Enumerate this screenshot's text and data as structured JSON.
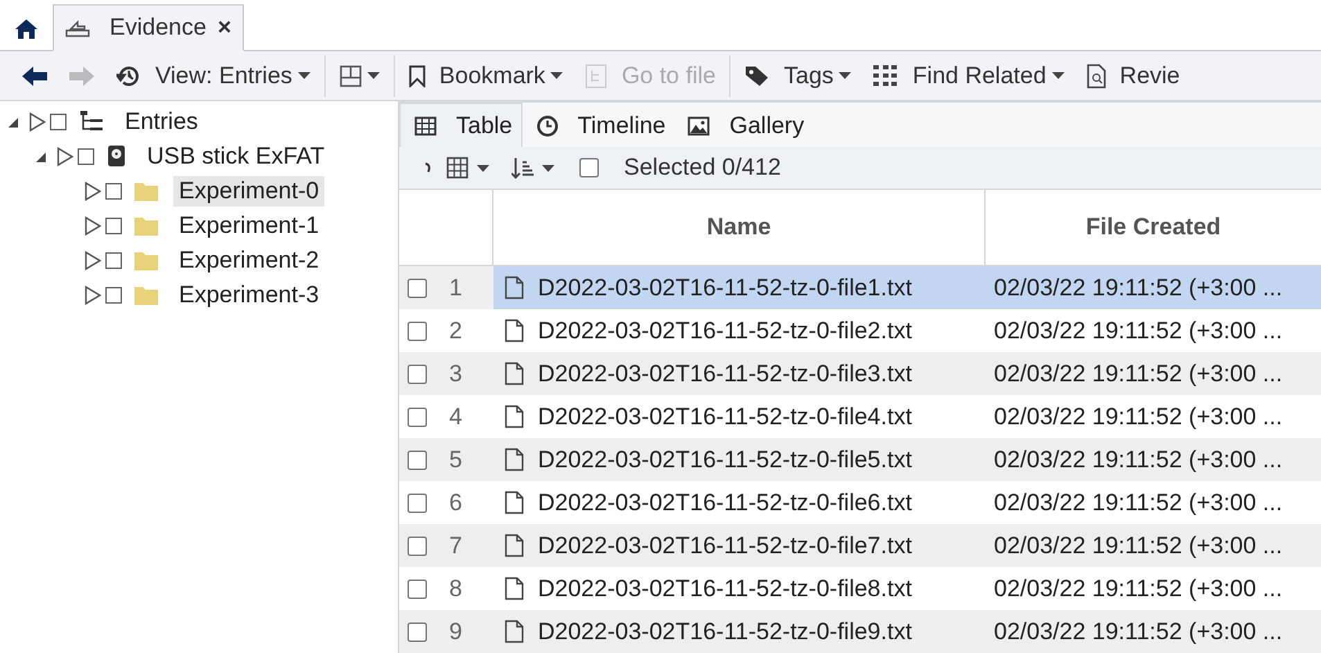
{
  "tabs": [
    {
      "kind": "home",
      "selected": false
    },
    {
      "kind": "case",
      "label": "Evidence",
      "close": "×",
      "selected": true
    }
  ],
  "toolbar": [
    {
      "kind": "back",
      "disabled": false
    },
    {
      "kind": "forward",
      "disabled": true
    },
    {
      "kind": "history",
      "label": "View: Entries",
      "dropdown": true,
      "disabled": false
    },
    {
      "kind": "separator"
    },
    {
      "kind": "layout",
      "dropdown": true,
      "disabled": false
    },
    {
      "kind": "separator"
    },
    {
      "kind": "bookmark",
      "label": "Bookmark",
      "dropdown": true,
      "disabled": false
    },
    {
      "kind": "goto",
      "label": "Go to file",
      "dropdown": false,
      "disabled": true
    },
    {
      "kind": "separator"
    },
    {
      "kind": "tags",
      "label": "Tags",
      "dropdown": true,
      "disabled": false
    },
    {
      "kind": "related",
      "label": "Find Related",
      "dropdown": true,
      "disabled": false
    },
    {
      "kind": "review",
      "label": "Revie",
      "dropdown": false,
      "disabled": false
    }
  ],
  "tree": [
    {
      "label": "Entries",
      "kind": "entries",
      "checked": false,
      "selected": false,
      "expanded": true,
      "children": [
        {
          "label": "USB stick ExFAT",
          "kind": "drive",
          "checked": false,
          "selected": false,
          "expanded": true,
          "children": [
            {
              "label": "Experiment-0",
              "kind": "folder",
              "checked": false,
              "selected": true
            },
            {
              "label": "Experiment-1",
              "kind": "folder",
              "checked": false,
              "selected": false
            },
            {
              "label": "Experiment-2",
              "kind": "folder",
              "checked": false,
              "selected": false
            },
            {
              "label": "Experiment-3",
              "kind": "folder",
              "checked": false,
              "selected": false
            }
          ]
        }
      ]
    }
  ],
  "view_tabs": [
    {
      "label": "Table",
      "kind": "table",
      "selected": true
    },
    {
      "label": "Timeline",
      "kind": "timeline",
      "selected": false
    },
    {
      "label": "Gallery",
      "kind": "gallery",
      "selected": false
    }
  ],
  "table_toolbar": {
    "select_all_checked": false,
    "selection": "Selected 0/412"
  },
  "table": {
    "columns": [
      "Name",
      "File Created"
    ],
    "rows": [
      {
        "number": "1",
        "name": "D2022-03-02T16-11-52-tz-0-file1.txt",
        "created": "02/03/22 19:11:52 (+3:00 ...",
        "checked": false,
        "selected": true
      },
      {
        "number": "2",
        "name": "D2022-03-02T16-11-52-tz-0-file2.txt",
        "created": "02/03/22 19:11:52 (+3:00 ...",
        "checked": false,
        "selected": false
      },
      {
        "number": "3",
        "name": "D2022-03-02T16-11-52-tz-0-file3.txt",
        "created": "02/03/22 19:11:52 (+3:00 ...",
        "checked": false,
        "selected": false
      },
      {
        "number": "4",
        "name": "D2022-03-02T16-11-52-tz-0-file4.txt",
        "created": "02/03/22 19:11:52 (+3:00 ...",
        "checked": false,
        "selected": false
      },
      {
        "number": "5",
        "name": "D2022-03-02T16-11-52-tz-0-file5.txt",
        "created": "02/03/22 19:11:52 (+3:00 ...",
        "checked": false,
        "selected": false
      },
      {
        "number": "6",
        "name": "D2022-03-02T16-11-52-tz-0-file6.txt",
        "created": "02/03/22 19:11:52 (+3:00 ...",
        "checked": false,
        "selected": false
      },
      {
        "number": "7",
        "name": "D2022-03-02T16-11-52-tz-0-file7.txt",
        "created": "02/03/22 19:11:52 (+3:00 ...",
        "checked": false,
        "selected": false
      },
      {
        "number": "8",
        "name": "D2022-03-02T16-11-52-tz-0-file8.txt",
        "created": "02/03/22 19:11:52 (+3:00 ...",
        "checked": false,
        "selected": false
      },
      {
        "number": "9",
        "name": "D2022-03-02T16-11-52-tz-0-file9.txt",
        "created": "02/03/22 19:11:52 (+3:00 ...",
        "checked": false,
        "selected": false
      }
    ]
  }
}
